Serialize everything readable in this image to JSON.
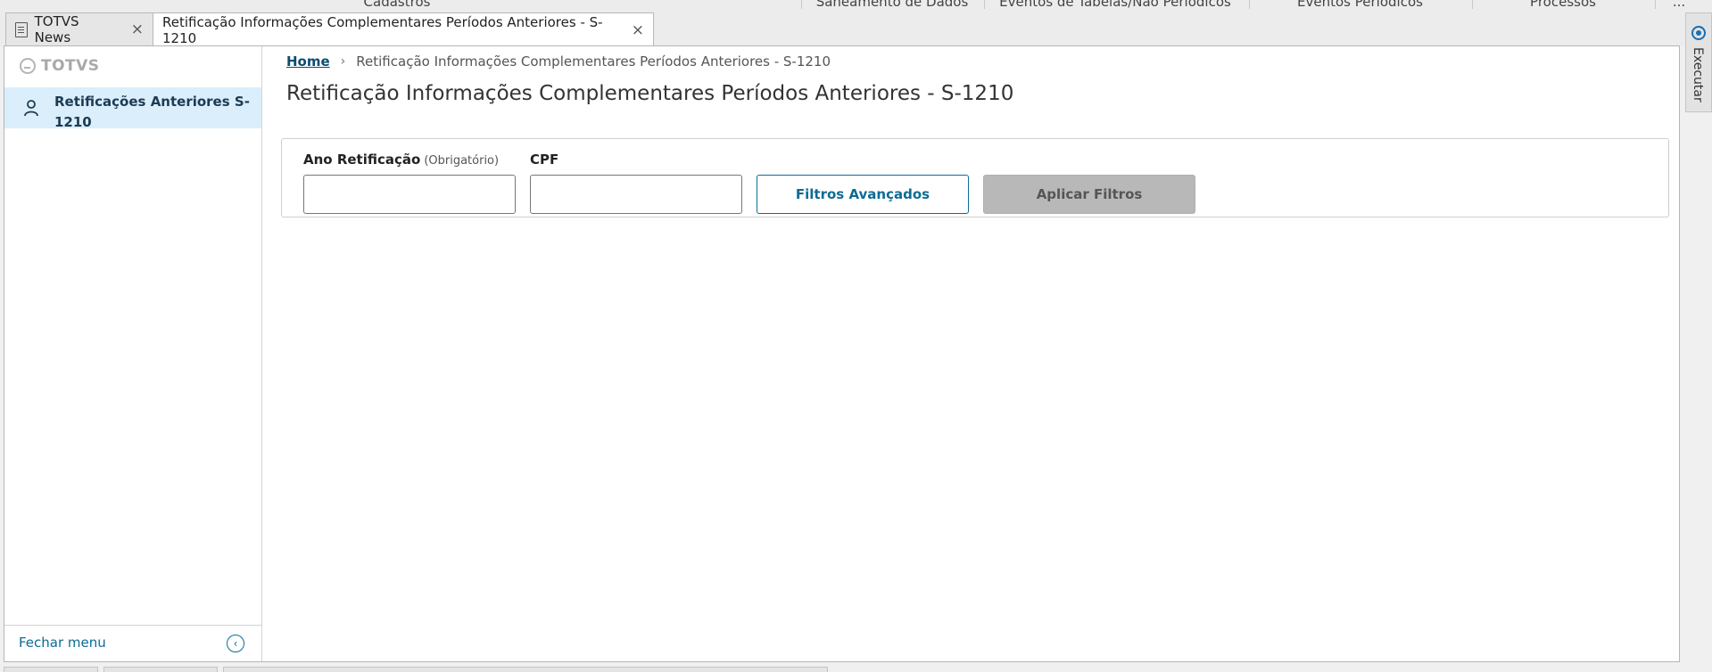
{
  "top_menu": {
    "items": [
      "Cadastros",
      "Saneamento de Dados",
      "Eventos de Tabelas/Não Periódicos",
      "Eventos Periódicos",
      "Processos",
      "..."
    ]
  },
  "tabs": [
    {
      "label": "TOTVS News",
      "active": false
    },
    {
      "label": "Retificação Informações Complementares Períodos Anteriores - S-1210",
      "active": true
    }
  ],
  "sidebar": {
    "logo": "TOTVS",
    "items": [
      {
        "label": "Retificações Anteriores S-1210",
        "icon": "user-icon"
      }
    ],
    "footer": {
      "close_label": "Fechar menu"
    }
  },
  "breadcrumb": {
    "home": "Home",
    "current": "Retificação Informações Complementares Períodos Anteriores - S-1210"
  },
  "page": {
    "title": "Retificação Informações Complementares Períodos Anteriores - S-1210"
  },
  "filters": {
    "year": {
      "label": "Ano Retificação",
      "required_hint": "(Obrigatório)",
      "value": ""
    },
    "cpf": {
      "label": "CPF",
      "value": ""
    },
    "advanced_button": "Filtros Avançados",
    "apply_button": "Aplicar Filtros"
  },
  "right_rail": {
    "label": "Executar"
  },
  "colors": {
    "accent": "#0c6c94",
    "selected_bg": "#daeefb",
    "disabled_bg": "#b8b8b8"
  }
}
